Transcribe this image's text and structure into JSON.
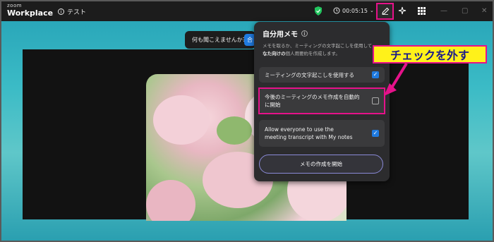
{
  "app": {
    "logo_small": "zoom",
    "logo_big": "Workplace",
    "meeting_name": "テスト",
    "timer": "00:05:15"
  },
  "ask": {
    "label": "何も聞こえませんか？",
    "button": "合"
  },
  "panel": {
    "title": "自分用メモ",
    "desc_line1": "メモを取るか、ミーティングの文字起こしを使用して",
    "desc_line2_bold": "なた向けの",
    "desc_line2": "個人用要約を作成します。",
    "options": [
      {
        "label": "ミーティングの文字起こしを使用する",
        "checked": true
      },
      {
        "label_l1": "今後のミーティングのメモ作成を自動的",
        "label_l2": "に開始",
        "checked": false
      },
      {
        "label_l1": "Allow everyone to use the",
        "label_l2": "meeting transcript with My notes",
        "checked": true
      }
    ],
    "start_button": "メモの作成を開始"
  },
  "callout": {
    "text": "チェックを外す"
  },
  "colors": {
    "accent_pink": "#e6128a",
    "callout_yellow": "#fff11a",
    "checkbox_blue": "#1f7ae0",
    "panel_bg": "#2c2c2e"
  }
}
